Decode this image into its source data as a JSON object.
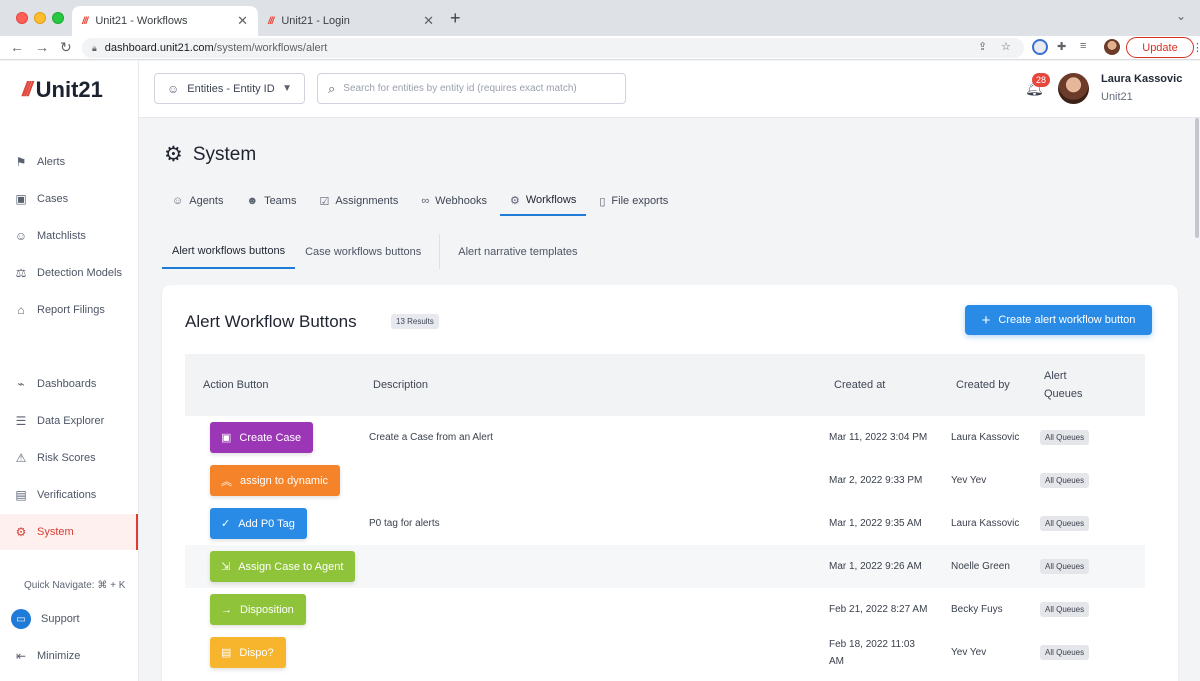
{
  "browser": {
    "tabs": [
      {
        "title": "Unit21 - Workflows",
        "favicon": "unit21-logo-icon",
        "active": true
      },
      {
        "title": "Unit21 - Login",
        "favicon": "unit21-logo-icon",
        "active": false
      }
    ],
    "url_host": "dashboard.unit21.com",
    "url_path": "/system/workflows/alert",
    "update_label": "Update"
  },
  "app": {
    "logo_text": "Unit21",
    "sidebar": {
      "items": [
        {
          "label": "Alerts",
          "icon": "flag-icon"
        },
        {
          "label": "Cases",
          "icon": "briefcase-icon"
        },
        {
          "label": "Matchlists",
          "icon": "user-x-icon"
        },
        {
          "label": "Detection Models",
          "icon": "scale-icon"
        },
        {
          "label": "Report Filings",
          "icon": "bank-icon"
        },
        {
          "label": "Dashboards",
          "icon": "line-chart-icon"
        },
        {
          "label": "Data Explorer",
          "icon": "search-list-icon"
        },
        {
          "label": "Risk Scores",
          "icon": "warning-icon"
        },
        {
          "label": "Verifications",
          "icon": "id-card-icon"
        },
        {
          "label": "System",
          "icon": "gear-icon",
          "active": true
        }
      ],
      "quick_navigate": "Quick Navigate: ⌘ + K",
      "support_label": "Support",
      "minimize_label": "Minimize"
    },
    "header": {
      "entity_select_value": "Entities - Entity ID",
      "search_placeholder": "Search for entities by entity id (requires exact match)",
      "notification_count": "28",
      "user_name": "Laura Kassovic",
      "user_org": "Unit21"
    },
    "page": {
      "title": "System",
      "tabs": [
        {
          "label": "Agents",
          "icon": "user-icon"
        },
        {
          "label": "Teams",
          "icon": "users-icon"
        },
        {
          "label": "Assignments",
          "icon": "clipboard-check-icon"
        },
        {
          "label": "Webhooks",
          "icon": "link-icon"
        },
        {
          "label": "Workflows",
          "icon": "gear-icon",
          "active": true
        },
        {
          "label": "File exports",
          "icon": "file-export-icon"
        }
      ],
      "subtabs": [
        {
          "label": "Alert workflows buttons",
          "active": true
        },
        {
          "label": "Case workflows buttons"
        },
        {
          "label": "Alert narrative templates"
        }
      ]
    },
    "card": {
      "title": "Alert Workflow Buttons",
      "results_badge": "13 Results",
      "create_button": "Create alert workflow button",
      "columns": [
        "Action Button",
        "Description",
        "Created at",
        "Created by",
        "Alert Queues"
      ],
      "rows": [
        {
          "button": "Create Case",
          "icon": "briefcase-icon",
          "color": "#9b36b7",
          "description": "Create a Case from an Alert",
          "created_at": "Mar 11, 2022 3:04 PM",
          "created_by": "Laura Kassovic",
          "queues": "All Queues"
        },
        {
          "button": "assign to dynamic",
          "icon": "double-chevron-up-icon",
          "color": "#f5832a",
          "description": "",
          "created_at": "Mar 2, 2022 9:33 PM",
          "created_by": "Yev Yev",
          "queues": "All Queues"
        },
        {
          "button": "Add P0 Tag",
          "icon": "check-circle-icon",
          "color": "#2a8be6",
          "description": "P0 tag for alerts",
          "created_at": "Mar 1, 2022 9:35 AM",
          "created_by": "Laura Kassovic",
          "queues": "All Queues"
        },
        {
          "button": "Assign Case to Agent",
          "icon": "assign-icon",
          "color": "#8fc43a",
          "description": "",
          "created_at": "Mar 1, 2022 9:26 AM",
          "created_by": "Noelle Green",
          "queues": "All Queues"
        },
        {
          "button": "Disposition",
          "icon": "arrow-right-icon",
          "color": "#8fc43a",
          "description": "",
          "created_at": "Feb 21, 2022 8:27 AM",
          "created_by": "Becky Fuys",
          "queues": "All Queues"
        },
        {
          "button": "Dispo?",
          "icon": "document-icon",
          "color": "#f6b52d",
          "description": "",
          "created_at": "Feb 18, 2022 11:03 AM",
          "created_by": "Yev Yev",
          "queues": "All Queues"
        }
      ]
    }
  }
}
